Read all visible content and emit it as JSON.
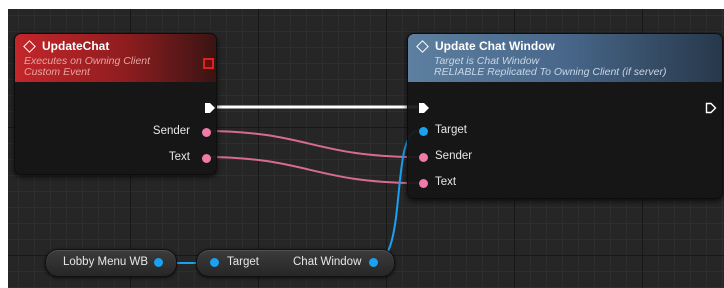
{
  "event_node": {
    "title": "UpdateChat",
    "subtitle_1": "Executes on Owning Client",
    "subtitle_2": "Custom Event",
    "pins": {
      "sender": "Sender",
      "text": "Text"
    }
  },
  "function_node": {
    "title": "Update Chat Window",
    "subtitle_1": "Target is Chat Window",
    "subtitle_2": "RELIABLE Replicated To Owning Client (if server)",
    "pins": {
      "target": "Target",
      "sender": "Sender",
      "text": "Text"
    }
  },
  "variable_node": {
    "label": "Lobby Menu WB"
  },
  "getter_node": {
    "target_label": "Target",
    "output_label": "Chat Window"
  },
  "colors": {
    "event_header": "#c4262a",
    "function_header": "#5d7fa0",
    "string_pin": "#f07aa8",
    "object_pin": "#1aa1f2",
    "exec_wire": "#ffffff"
  },
  "icons": {
    "event": "diamond-event-icon",
    "function": "diamond-function-icon",
    "replication": "replicated-indicator-icon"
  }
}
